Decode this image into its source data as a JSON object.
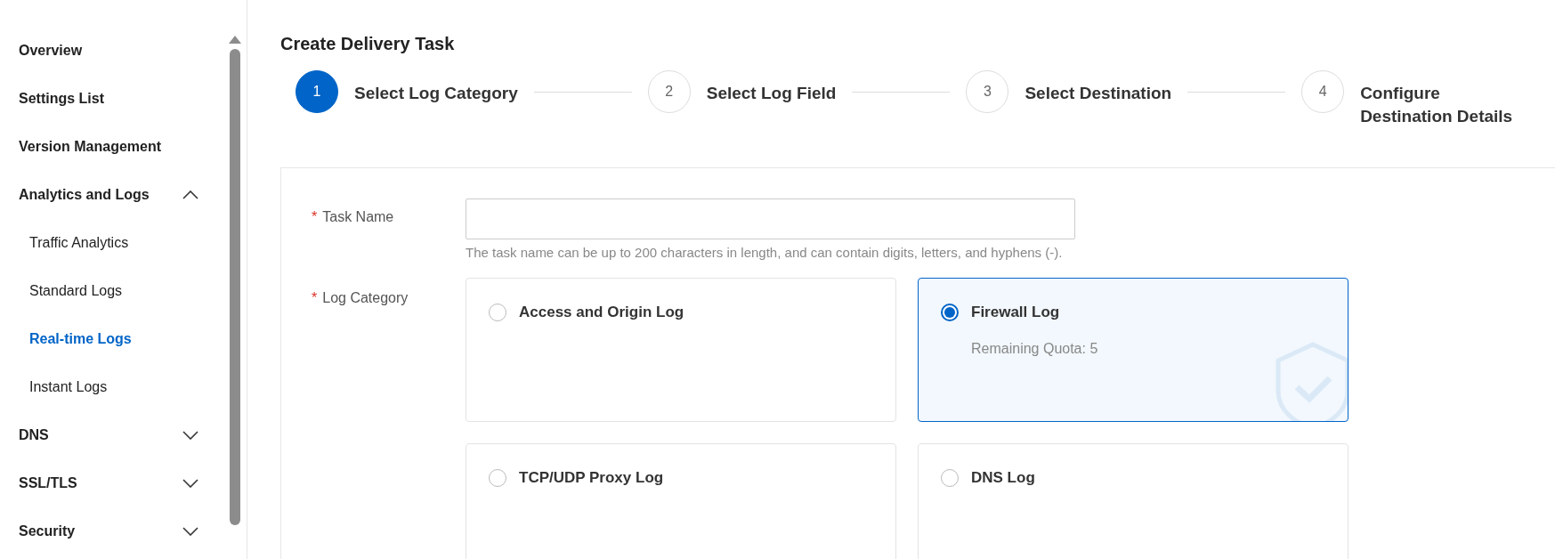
{
  "sidebar": {
    "items": [
      {
        "label": "Overview",
        "selected": false
      },
      {
        "label": "Settings List",
        "selected": false
      },
      {
        "label": "Version Management",
        "selected": false
      },
      {
        "label": "Analytics and Logs",
        "selected": false,
        "expanded": true,
        "children": [
          {
            "label": "Traffic Analytics",
            "selected": false
          },
          {
            "label": "Standard Logs",
            "selected": false
          },
          {
            "label": "Real-time Logs",
            "selected": true
          },
          {
            "label": "Instant Logs",
            "selected": false
          }
        ]
      },
      {
        "label": "DNS",
        "selected": false,
        "expanded": false
      },
      {
        "label": "SSL/TLS",
        "selected": false,
        "expanded": false
      },
      {
        "label": "Security",
        "selected": false,
        "expanded": false
      }
    ]
  },
  "page": {
    "title": "Create Delivery Task"
  },
  "steps": [
    {
      "number": "1",
      "label": "Select Log Category",
      "selected": true
    },
    {
      "number": "2",
      "label": "Select Log Field",
      "selected": false
    },
    {
      "number": "3",
      "label": "Select Destination",
      "selected": false
    },
    {
      "number": "4",
      "label": "Configure Destination Details",
      "selected": false
    }
  ],
  "form": {
    "task_name": {
      "label": "Task Name",
      "required_mark": "*",
      "hint": "The task name can be up to 200 characters in length, and can contain digits, letters, and hyphens (-)."
    },
    "log_category": {
      "label": "Log Category",
      "required_mark": "*",
      "options": [
        {
          "label": "Access and Origin Log",
          "selected": false
        },
        {
          "label": "Firewall Log",
          "selected": true,
          "quota": "Remaining Quota: 5"
        },
        {
          "label": "TCP/UDP Proxy Log",
          "selected": false
        },
        {
          "label": "DNS Log",
          "selected": false
        }
      ]
    }
  }
}
